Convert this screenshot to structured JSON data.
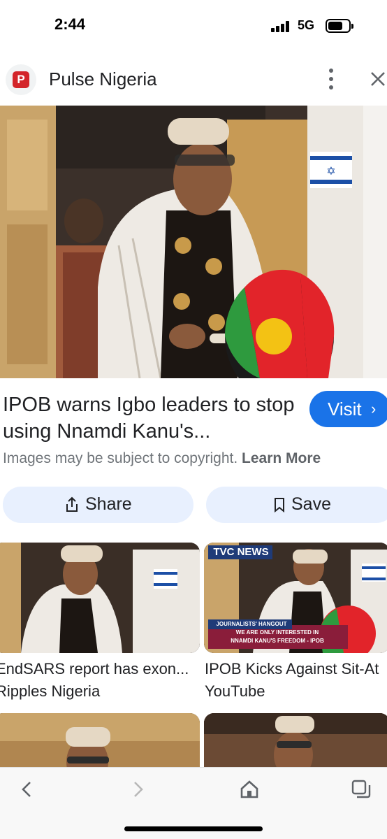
{
  "status_bar": {
    "time": "2:44",
    "network": "5G"
  },
  "header": {
    "source_name": "Pulse Nigeria",
    "favicon_letter": "P",
    "icons": [
      "more-vert-icon",
      "close-icon"
    ]
  },
  "result": {
    "title": "IPOB warns Igbo leaders to stop using Nnamdi Kanu's...",
    "visit_label": "Visit",
    "copyright_text": "Images may be subject to copyright.",
    "learn_more_label": "Learn More",
    "share_label": "Share",
    "save_label": "Save"
  },
  "related": [
    {
      "caption": "EndSARS report has exon...",
      "source": "Ripples Nigeria"
    },
    {
      "caption": "IPOB Kicks Against Sit-At",
      "source": "YouTube",
      "overlay": {
        "channel": "TVC NEWS",
        "banner_top": "JOURNALISTS' HANGOUT",
        "banner_line1": "WE ARE ONLY INTERESTED IN",
        "banner_line2": "NNAMDI KANU'S FREEDOM - IPOB"
      }
    }
  ],
  "colors": {
    "accent": "#1a73e8",
    "chip_bg": "#e8f0fe",
    "favicon": "#d3252a"
  }
}
